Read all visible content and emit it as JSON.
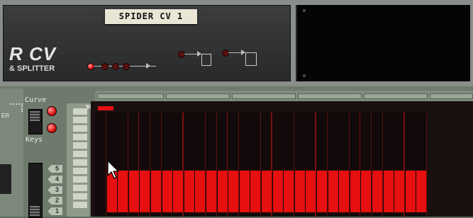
{
  "device_label": "SPIDER CV 1",
  "brand": {
    "name": "R CV",
    "subtitle": "& SPLITTER"
  },
  "sequencer": {
    "curve_label": "Curve",
    "keys_label": "Keys",
    "side_label": "ER",
    "octave_numbers": [
      "5",
      "4",
      "3",
      "2",
      "1"
    ]
  },
  "grid": {
    "steps": 32,
    "visible_steps": 30,
    "value_levels": [
      0,
      1,
      1,
      1,
      1,
      1,
      1,
      1,
      1,
      1,
      1,
      1,
      1,
      1,
      1,
      1,
      1,
      1,
      1,
      1,
      1,
      1,
      1,
      1,
      1,
      1,
      1,
      1,
      1,
      1
    ],
    "bar_color": "#e61010"
  },
  "icons": [
    "mouse-pointer-icon"
  ]
}
